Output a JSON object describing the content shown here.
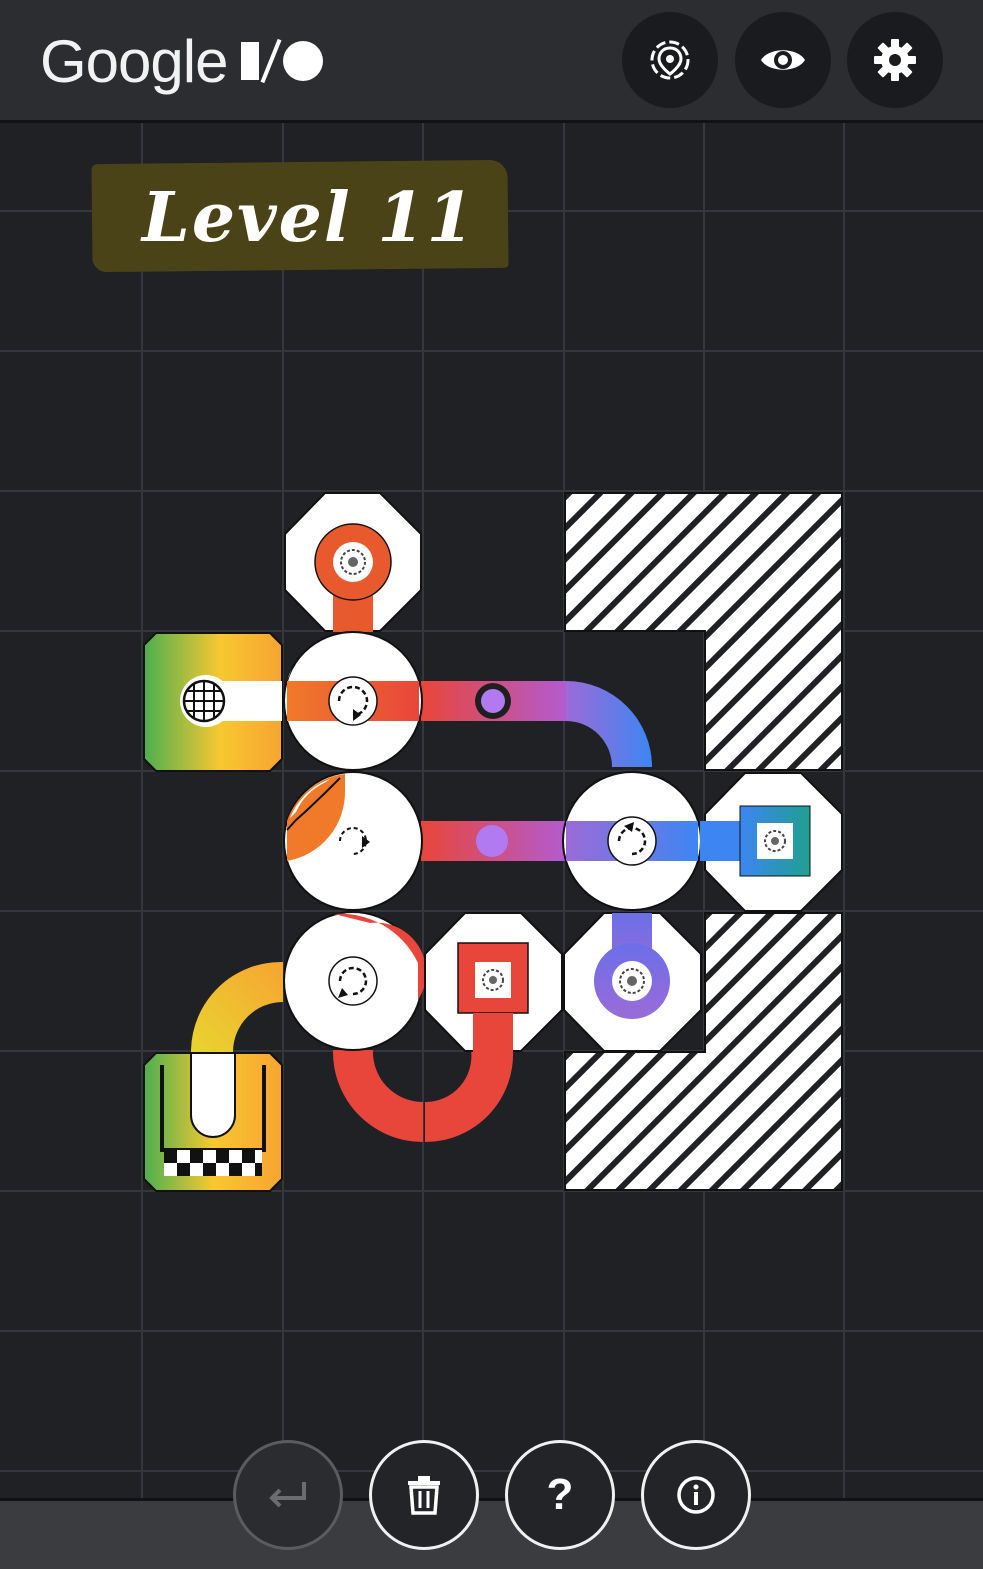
{
  "header": {
    "brand_google": "Google",
    "buttons": [
      {
        "name": "target-icon",
        "label": "locate"
      },
      {
        "name": "eye-icon",
        "label": "view"
      },
      {
        "name": "gear-icon",
        "label": "settings"
      }
    ]
  },
  "level": {
    "title": "Level 11"
  },
  "footer": {
    "buttons": [
      {
        "name": "undo-button",
        "icon": "return-arrow-icon",
        "enabled": false
      },
      {
        "name": "delete-button",
        "icon": "trash-icon",
        "enabled": true
      },
      {
        "name": "help-button",
        "icon": "question-icon",
        "label": "?",
        "enabled": true
      },
      {
        "name": "info-button",
        "icon": "info-icon",
        "enabled": true
      }
    ]
  },
  "colors": {
    "background": "#1f2125",
    "grid": "#35373c",
    "topbar": "#2b2d31",
    "level_band": "#4a4318",
    "red": "#e8463a",
    "orange": "#f07a2a",
    "purple": "#9b6bd8",
    "blue": "#3d86f2",
    "teal": "#1f9f8f",
    "yellow": "#f7c831",
    "green": "#4caf50"
  },
  "tiles": [
    {
      "type": "source",
      "icon": "globe-icon"
    },
    {
      "type": "goal",
      "icon": "checkered-flag-icon"
    },
    {
      "type": "rotator",
      "icon": "rotate-icon",
      "count": 4
    },
    {
      "type": "cap",
      "icon": "target-icon",
      "count": 5
    },
    {
      "type": "blocked",
      "icon": "hatch-pattern",
      "count": 2
    }
  ]
}
